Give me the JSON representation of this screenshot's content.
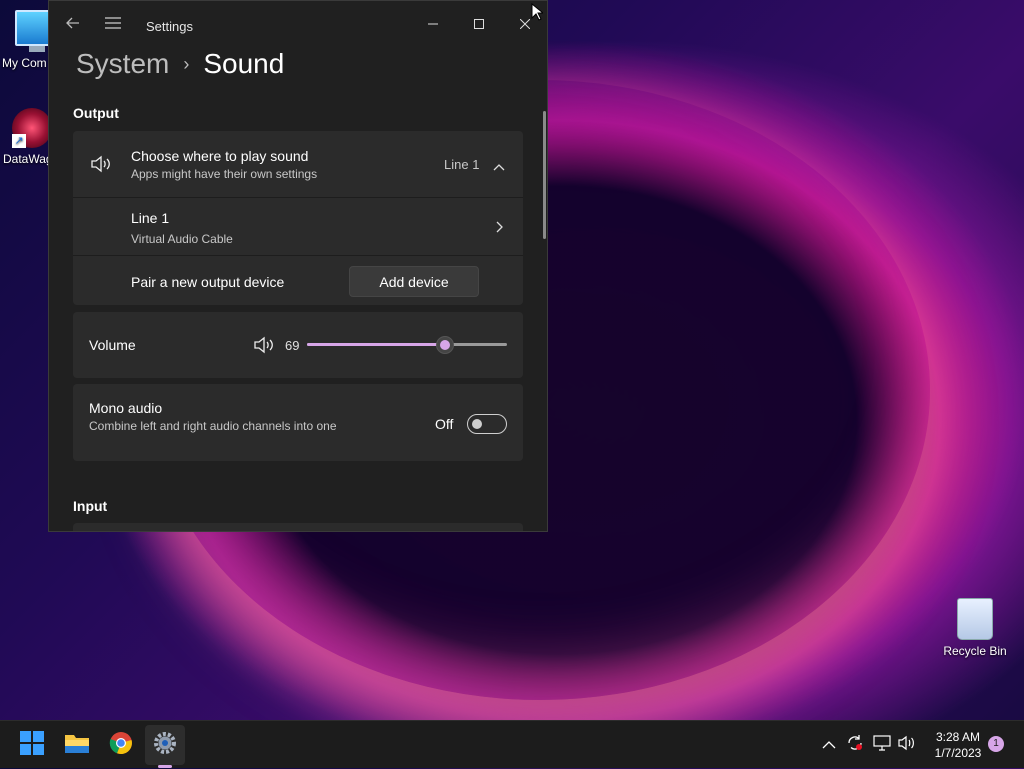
{
  "desktop": {
    "icons": [
      {
        "label": "My Com",
        "icon": "computer-icon"
      },
      {
        "label": "DataWag",
        "icon": "datawagon-icon"
      },
      {
        "label": "Recycle Bin",
        "icon": "recycle-bin-icon"
      }
    ]
  },
  "window": {
    "app_title": "Settings",
    "controls": {
      "minimize": "minimize-icon",
      "maximize": "maximize-icon",
      "close": "close-icon"
    },
    "breadcrumb": {
      "parent": "System",
      "separator": "›",
      "current": "Sound"
    }
  },
  "output": {
    "section_title": "Output",
    "choose_device": {
      "title": "Choose where to play sound",
      "subtitle": "Apps might have their own settings",
      "selected": "Line 1",
      "icon": "speaker-icon",
      "expanded": true
    },
    "devices": [
      {
        "name": "Line 1",
        "description": "Virtual Audio Cable"
      }
    ],
    "pair": {
      "label": "Pair a new output device",
      "button": "Add device"
    },
    "volume": {
      "label": "Volume",
      "value": 69,
      "display": "69",
      "accent": "#d7a6e8"
    },
    "mono_audio": {
      "title": "Mono audio",
      "description": "Combine left and right audio channels into one",
      "state_label": "Off",
      "enabled": false
    }
  },
  "input": {
    "section_title": "Input"
  },
  "taskbar": {
    "apps": [
      {
        "name": "Start",
        "icon": "windows-start-icon"
      },
      {
        "name": "File Explorer",
        "icon": "folder-icon"
      },
      {
        "name": "Google Chrome",
        "icon": "chrome-icon"
      },
      {
        "name": "Settings",
        "icon": "settings-gear-icon",
        "active": true
      }
    ],
    "tray": {
      "icons": [
        "chevron-up-icon",
        "sync-icon",
        "network-icon",
        "volume-icon"
      ],
      "time": "3:28 AM",
      "date": "1/7/2023",
      "notification_count": "1"
    }
  }
}
